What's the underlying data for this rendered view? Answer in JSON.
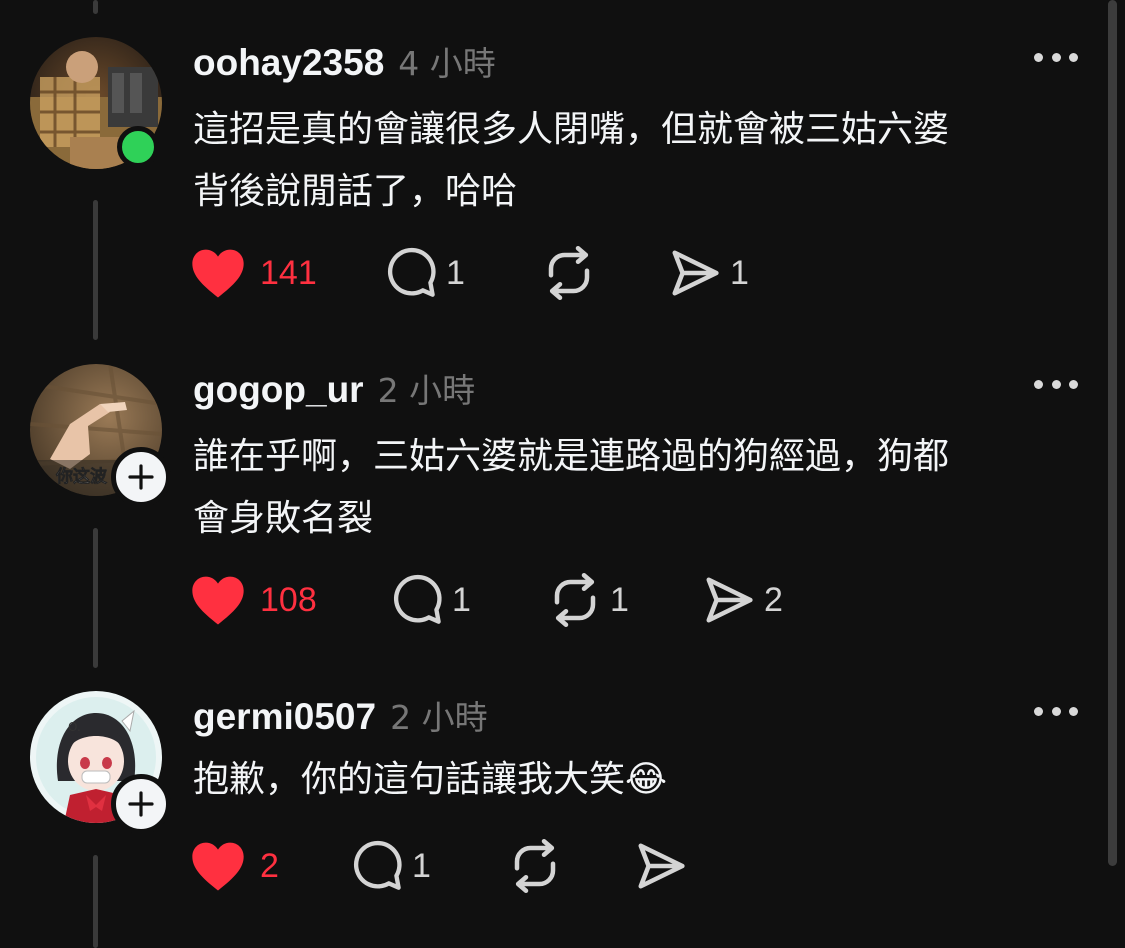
{
  "comments": [
    {
      "username": "oohay2358",
      "time": "4 小時",
      "text_lines": [
        "這招是真的會讓很多人閉嘴，但就會被三姑六婆",
        "背後說閒話了，哈哈"
      ],
      "avatar_status": "online",
      "likes": "141",
      "replies": "1",
      "reposts": "",
      "shares": "1"
    },
    {
      "username": "gogop_ur",
      "time": "2 小時",
      "text_lines": [
        "誰在乎啊，三姑六婆就是連路過的狗經過，狗都",
        "會身敗名裂"
      ],
      "avatar_text": "你这波",
      "likes": "108",
      "replies": "1",
      "reposts": "1",
      "shares": "2"
    },
    {
      "username": "germi0507",
      "time": "2 小時",
      "text_lines": [
        "抱歉，你的這句話讓我大笑😂"
      ],
      "likes": "2",
      "replies": "1",
      "reposts": "",
      "shares": ""
    }
  ],
  "colors": {
    "background": "#101010",
    "like_red": "#ff3040",
    "online_green": "#2fd158",
    "muted": "#777777"
  },
  "icons": [
    "heart-icon",
    "comment-icon",
    "repost-icon",
    "share-icon",
    "more-icon",
    "plus-icon"
  ]
}
